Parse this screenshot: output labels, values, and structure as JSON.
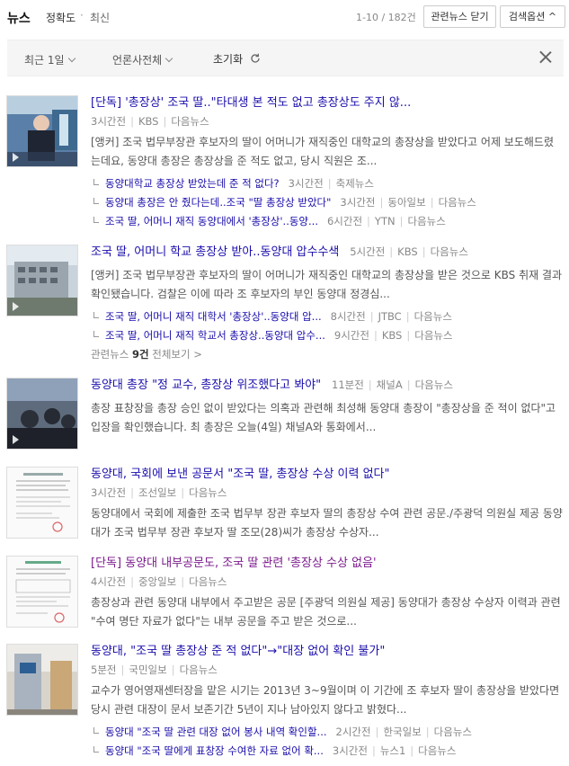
{
  "topbar": {
    "title": "뉴스",
    "sort_accuracy": "정확도",
    "dot": "·",
    "sort_latest": "최신",
    "count": "1-10 / 182건",
    "related_btn": "관련뉴스 닫기",
    "search_options_btn": "검색옵션 ^"
  },
  "filters": {
    "period": "최근 1일",
    "press": "언론사전체",
    "reset": "초기화"
  },
  "articles": [
    {
      "title": "[단독] '총장상' 조국 딸..\"타대생 본 적도 없고 총장상도 주지 않...",
      "time": "3시간전",
      "press": "KBS",
      "source": "다음뉴스",
      "desc": "[앵커] 조국 법무부장관 후보자의 딸이 어머니가 재직중인 대학교의 총장상을 받았다고 어제 보도해드렸는데요, 동양대 총장은 총장상을 준 적도 없고, 당시 직원은 조...",
      "subs": [
        {
          "title": "동양대학교 총장상 받았는데 준 적 없다?",
          "time": "3시간전",
          "press": "축제뉴스"
        },
        {
          "title": "동양대 총장은 안 줬다는데..조국 \"딸 총장상 받았다\"",
          "time": "3시간전",
          "press": "동아일보",
          "source": "다음뉴스"
        },
        {
          "title": "조국 딸, 어머니 재직 동양대에서 '총장상'..동양...",
          "time": "6시간전",
          "press": "YTN",
          "source": "다음뉴스"
        }
      ]
    },
    {
      "title": "조국 딸, 어머니 학교 총장상 받아..동양대 압수수색",
      "time": "5시간전",
      "press": "KBS",
      "source": "다음뉴스",
      "desc": "[앵커] 조국 법무부장관 후보자의 딸이 어머니가 재직중인 대학교의 총장상을 받은 것으로 KBS 취재 결과 확인됐습니다. 검찰은 이에 따라 조 후보자의 부인 동양대 정경심...",
      "subs": [
        {
          "title": "조국 딸, 어머니 재직 대학서 '총장상'..동양대 압...",
          "time": "8시간전",
          "press": "JTBC",
          "source": "다음뉴스"
        },
        {
          "title": "조국 딸, 어머니 재직 학교서 총장상..동양대 압수...",
          "time": "9시간전",
          "press": "KBS",
          "source": "다음뉴스"
        }
      ],
      "more_prefix": "관련뉴스",
      "more_count": "9건",
      "more_suffix": "전체보기 >"
    },
    {
      "title": "동양대 총장 \"정 교수, 총장상 위조했다고 봐야\"",
      "time": "11분전",
      "press": "채널A",
      "source": "다음뉴스",
      "desc": "총장 표창장을 총장 승인 없이 받았다는 의혹과 관련해 최성해 동양대 총장이 \"총장상을 준 적이 없다\"고 입장을 확인했습니다. 최 총장은 오늘(4일) 채널A와 통화에서..."
    },
    {
      "title": "동양대, 국회에 보낸 공문서 \"조국 딸, 총장상 수상 이력 없다\"",
      "time": "3시간전",
      "press": "조선일보",
      "source": "다음뉴스",
      "desc": "동양대에서 국회에 제출한 조국 법무부 장관 후보자 딸의 총장상 수여 관련 공문./주광덕 의원실 제공 동양대가 조국 법무부 장관 후보자 딸 조모(28)씨가 총장상 수상자..."
    },
    {
      "title": "[단독] 동양대 내부공문도, 조국 딸 관련 '총장상 수상 없음'",
      "time": "4시간전",
      "press": "중앙일보",
      "source": "다음뉴스",
      "desc": "총장상과 관련 동양대 내부에서 주고받은 공문 [주광덕 의원실 제공] 동양대가 총장상 수상자 이력과 관련 \"수여 명단 자료가 없다\"는 내부 공문을 주고 받은 것으로..."
    },
    {
      "title": "동양대, \"조국 딸 총장상 준 적 없다\"→\"대장 없어 확인 불가\"",
      "time": "5분전",
      "press": "국민일보",
      "source": "다음뉴스",
      "desc": "교수가 영어영재센터장을 맡은 시기는 2013년 3~9월이며 이 기간에 조 후보자 딸이 총장상을 받았다면 당시 관련 대장이 문서 보존기간 5년이 지나 남아있지 않다고 밝혔다...",
      "subs": [
        {
          "title": "동양대 \"조국 딸 관련 대장 없어 봉사 내역 확인할...",
          "time": "2시간전",
          "press": "한국일보",
          "source": "다음뉴스"
        },
        {
          "title": "동양대 \"조국 딸에게 표창장 수여한 자료 없어 확...",
          "time": "3시간전",
          "press": "뉴스1",
          "source": "다음뉴스"
        }
      ]
    }
  ]
}
